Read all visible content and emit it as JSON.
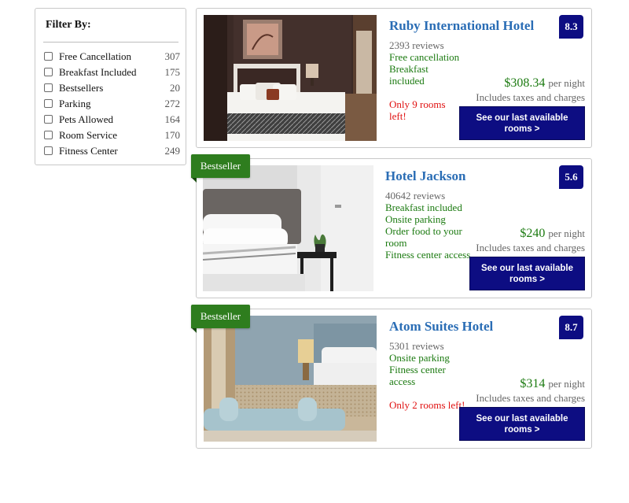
{
  "filters": {
    "title": "Filter By:",
    "items": [
      {
        "label": "Free Cancellation",
        "count": "307"
      },
      {
        "label": "Breakfast Included",
        "count": "175"
      },
      {
        "label": "Bestsellers",
        "count": "20"
      },
      {
        "label": "Parking",
        "count": "272"
      },
      {
        "label": "Pets Allowed",
        "count": "164"
      },
      {
        "label": "Room Service",
        "count": "170"
      },
      {
        "label": "Fitness Center",
        "count": "249"
      }
    ]
  },
  "hotels": [
    {
      "name": "Ruby International Hotel",
      "score": "8.3",
      "reviews": "2393 reviews",
      "features": [
        "Free cancellation",
        "Breakfast",
        "included"
      ],
      "urgent": "Only 9 rooms left!",
      "price": "$308.34",
      "per_night": "per night",
      "taxes": "Includes taxes and charges",
      "cta": "See our last available rooms >",
      "badge": ""
    },
    {
      "name": "Hotel Jackson",
      "score": "5.6",
      "reviews": "40642 reviews",
      "features": [
        "Breakfast included",
        "Onsite parking",
        "Order food to your",
        "room",
        "Fitness center access"
      ],
      "urgent": "",
      "price": "$240",
      "per_night": "per night",
      "taxes": "Includes taxes and charges",
      "cta": "See our last available rooms >",
      "badge": "Bestseller"
    },
    {
      "name": "Atom Suites Hotel",
      "score": "8.7",
      "reviews": "5301 reviews",
      "features": [
        "Onsite parking",
        "Fitness center",
        "access"
      ],
      "urgent": "Only 2 rooms left!",
      "price": "$314",
      "per_night": "per night",
      "taxes": "Includes taxes and charges",
      "cta": "See our last available rooms >",
      "badge": "Bestseller"
    }
  ],
  "colors": {
    "accent_navy": "#0d0d82",
    "link_blue": "#2a6db5",
    "feature_green": "#1b7a10",
    "urgent_red": "#e01010",
    "badge_green": "#2e7d1e"
  }
}
